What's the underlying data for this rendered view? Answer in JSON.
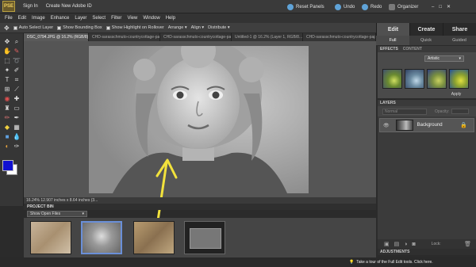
{
  "topbar": {
    "logo": "PSE",
    "sign_in": "Sign In",
    "create_id": "Create New Adobe ID",
    "reset_panels": "Reset Panels",
    "undo": "Undo",
    "redo": "Redo",
    "organizer": "Organizer"
  },
  "menu": [
    "File",
    "Edit",
    "Image",
    "Enhance",
    "Layer",
    "Select",
    "Filter",
    "View",
    "Window",
    "Help"
  ],
  "options": {
    "auto_select": "Auto Select Layer",
    "bounding_box": "Show Bounding Box",
    "highlight": "Show Highlight on Rollover",
    "arrange": "Arrange",
    "align": "Align",
    "distribute": "Distribute"
  },
  "doc_tabs": [
    "DSC_0794.JPG @ 16.2% (RGB/8) *",
    "CHD-sarasschmuto-countrycottage-paper21.jpg @ 11...",
    "CHD-sarasschmuto-countrycottage-paper38.jpg @ 11...",
    "Untitled-1 @ 16.2% (Layer 1, RGB/8...",
    "CHD-sarasschmuto-countrycottage-paper28.jpg @ 11..."
  ],
  "mode_tabs": [
    "Edit",
    "Create",
    "Share"
  ],
  "sub_tabs": [
    "Full",
    "Quick",
    "Guided"
  ],
  "status": "16.24%   12.907 inches x 8.64 inches (3...",
  "project_bin": {
    "header": "PROJECT BIN",
    "select": "Show Open Files"
  },
  "effects": {
    "tabs": [
      "EFFECTS",
      "CONTENT"
    ],
    "select": "Artistic",
    "apply": "Apply"
  },
  "layers": {
    "header": "LAYERS",
    "blend": "Normal",
    "opacity_label": "Opacity:",
    "layer_name": "Background",
    "lock_label": "Lock:"
  },
  "adjustments_header": "ADJUSTMENTS",
  "tour_text": "Take a tour of the Full Edit tools. Click here.",
  "colors": {
    "accent": "#5fa3d8",
    "annotation": "#f2e23c",
    "foreground_swatch": "#1010d0",
    "background_swatch": "#ffffff"
  }
}
